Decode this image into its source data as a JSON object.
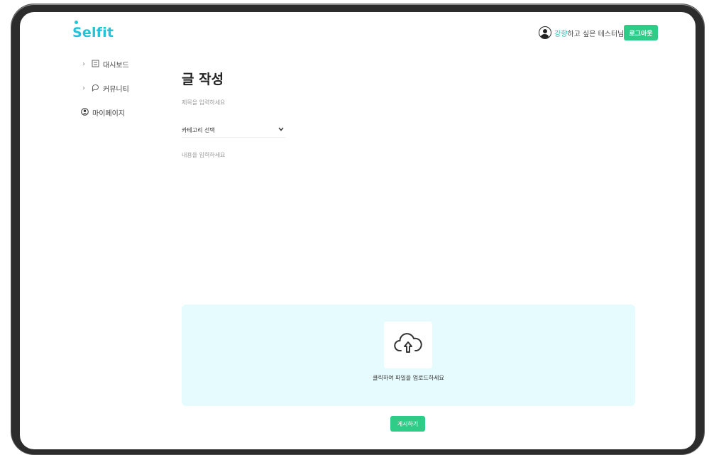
{
  "brand": {
    "name": "Selfit",
    "color": "#22c3d8"
  },
  "header": {
    "user_highlight": "강향",
    "user_rest": "하고 싶은 테스터님",
    "logout_label": "로그아웃"
  },
  "sidebar": {
    "items": [
      {
        "label": "대시보드",
        "icon": "dashboard-icon",
        "chevron": "›"
      },
      {
        "label": "커뮤니티",
        "icon": "chat-icon",
        "chevron": "›"
      },
      {
        "label": "마이페이지",
        "icon": "user-icon"
      }
    ]
  },
  "main": {
    "page_title": "글 작성",
    "title_placeholder": "제목을 입력하세요",
    "category_selected": "카테고리 선택",
    "content_placeholder": "내용을 입력하세요",
    "upload_text": "클릭하여 파일을 업로드하세요",
    "post_label": "게시하기"
  },
  "colors": {
    "accent_green": "#2ecc87",
    "upload_bg": "#e6fbfd"
  }
}
